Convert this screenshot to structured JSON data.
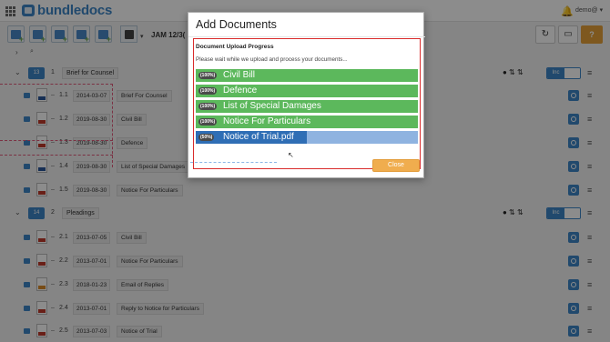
{
  "brand": {
    "name": "bundledocs",
    "color": "#3d86c6"
  },
  "user": {
    "name": "demo@"
  },
  "toolbar": {
    "case_title": "JAM 12/3("
  },
  "sections": [
    {
      "badge": "13",
      "number": "1",
      "title": "Brief for Counsel",
      "items": [
        {
          "number": "1.1",
          "date": "2014-03-07",
          "title": "Brief For Counsel",
          "type": "word"
        },
        {
          "number": "1.2",
          "date": "2019-08-30",
          "title": "Civil Bill",
          "type": "pdf"
        },
        {
          "number": "1.3",
          "date": "2019-08-30",
          "title": "Defence",
          "type": "pdf"
        },
        {
          "number": "1.4",
          "date": "2019-08-30",
          "title": "List of Special Damages",
          "type": "word"
        },
        {
          "number": "1.5",
          "date": "2019-08-30",
          "title": "Notice For Particulars",
          "type": "pdf"
        }
      ]
    },
    {
      "badge": "14",
      "number": "2",
      "title": "Pleadings",
      "items": [
        {
          "number": "2.1",
          "date": "2013-07-05",
          "title": "Civil Bill",
          "type": "pdf"
        },
        {
          "number": "2.2",
          "date": "2013-07-01",
          "title": "Notice For Particulars",
          "type": "pdf"
        },
        {
          "number": "2.3",
          "date": "2018-01-23",
          "title": "Email of Replies",
          "type": "msg"
        },
        {
          "number": "2.4",
          "date": "2013-07-01",
          "title": "Reply to Notice for Particulars",
          "type": "pdf"
        },
        {
          "number": "2.5",
          "date": "2013-07-03",
          "title": "Notice of Trial",
          "type": "pdf"
        }
      ]
    }
  ],
  "inc_toggle": {
    "label": "Inc"
  },
  "modal": {
    "title": "Add Documents",
    "heading": "Document Upload Progress",
    "message": "Please wait while we upload and process your documents...",
    "uploads": [
      {
        "percent_label": "(100%)",
        "name": "Civil Bill",
        "progress": 100
      },
      {
        "percent_label": "(100%)",
        "name": "Defence",
        "progress": 100
      },
      {
        "percent_label": "(100%)",
        "name": "List of Special Damages",
        "progress": 100
      },
      {
        "percent_label": "(100%)",
        "name": "Notice For Particulars",
        "progress": 100
      },
      {
        "percent_label": "(50%)",
        "name": "Notice of Trial.pdf",
        "progress": 50
      }
    ],
    "close_label": "Close"
  },
  "colors": {
    "success": "#5cb85c",
    "progress": "#2f6eb5",
    "pending": "#8fb3e0",
    "warning": "#f0ad4e"
  }
}
